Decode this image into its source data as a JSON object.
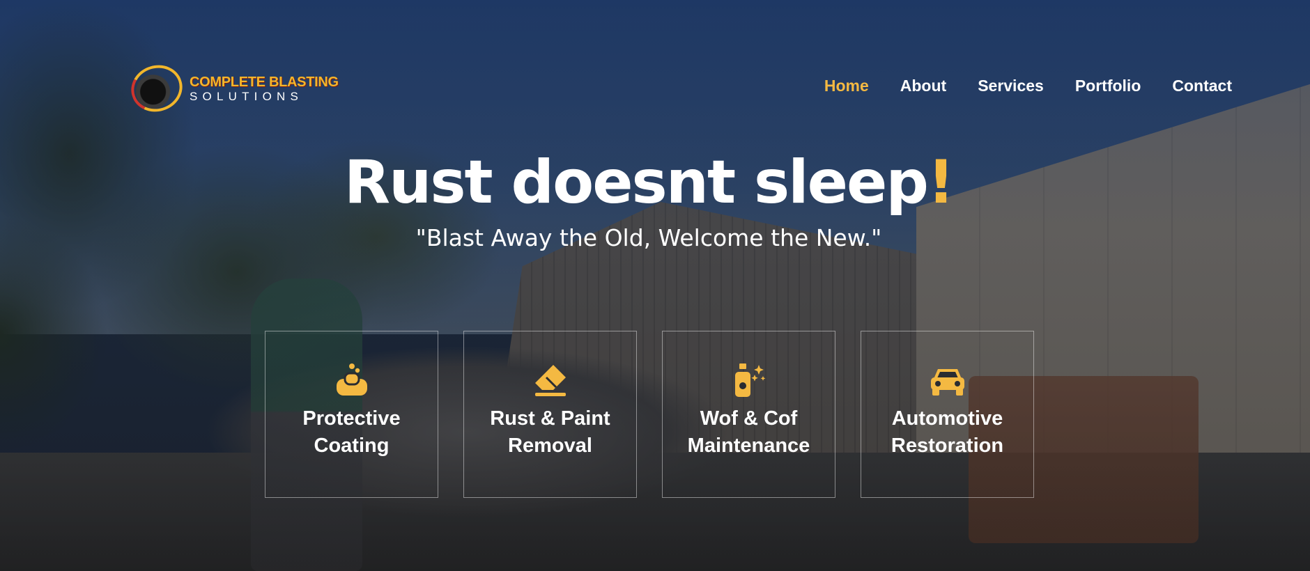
{
  "brand": {
    "name_line1": "COMPLETE BLASTING",
    "name_line2": "SOLUTIONS",
    "accent_color": "#f4b942"
  },
  "nav": {
    "items": [
      {
        "label": "Home",
        "active": true
      },
      {
        "label": "About",
        "active": false
      },
      {
        "label": "Services",
        "active": false
      },
      {
        "label": "Portfolio",
        "active": false
      },
      {
        "label": "Contact",
        "active": false
      }
    ]
  },
  "hero": {
    "headline": "Rust doesnt sleep",
    "headline_punct": "!",
    "subtitle": "\"Blast Away the Old, Welcome the New.\""
  },
  "services": [
    {
      "line1": "Protective",
      "line2": "Coating",
      "icon": "soap-bubbles-icon"
    },
    {
      "line1": "Rust & Paint",
      "line2": "Removal",
      "icon": "eraser-icon"
    },
    {
      "line1": "Wof & Cof",
      "line2": "Maintenance",
      "icon": "spray-bottle-sparkle-icon"
    },
    {
      "line1": "Automotive",
      "line2": "Restoration",
      "icon": "car-icon"
    }
  ]
}
